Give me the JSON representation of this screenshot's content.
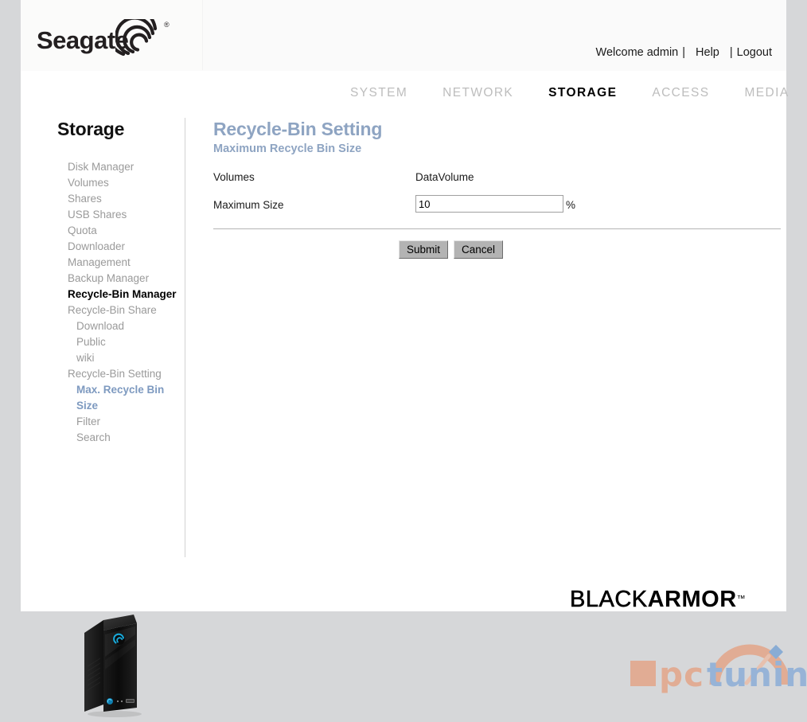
{
  "brand": {
    "logo_text": "Seagate",
    "logo_registered_mark": "®",
    "footer_brand_primary": "BLACK",
    "footer_brand_secondary": "ARMOR",
    "footer_brand_tm": "™",
    "accent_color": "#8ea4c2",
    "active_nav_color": "#000000",
    "inactive_nav_color": "#bdbdbd",
    "page_background": "#d6d7d9"
  },
  "account": {
    "welcome": "Welcome admin",
    "separator": "|",
    "help": "Help",
    "logout": "Logout"
  },
  "nav": {
    "items": [
      {
        "label": "SYSTEM",
        "active": false
      },
      {
        "label": "NETWORK",
        "active": false
      },
      {
        "label": "STORAGE",
        "active": true
      },
      {
        "label": "ACCESS",
        "active": false
      },
      {
        "label": "MEDIA",
        "active": false
      }
    ]
  },
  "sidebar": {
    "title": "Storage",
    "items": [
      {
        "label": "Disk Manager",
        "level": 1,
        "state": "normal"
      },
      {
        "label": "Volumes",
        "level": 1,
        "state": "normal"
      },
      {
        "label": "Shares",
        "level": 1,
        "state": "normal"
      },
      {
        "label": "USB Shares",
        "level": 1,
        "state": "normal"
      },
      {
        "label": "Quota",
        "level": 1,
        "state": "normal"
      },
      {
        "label": "Downloader Management",
        "level": 1,
        "state": "normal"
      },
      {
        "label": "Backup Manager",
        "level": 1,
        "state": "normal"
      },
      {
        "label": "Recycle-Bin Manager",
        "level": 1,
        "state": "active-dark"
      },
      {
        "label": "Recycle-Bin Share",
        "level": 1,
        "state": "normal"
      },
      {
        "label": "Download",
        "level": 2,
        "state": "normal"
      },
      {
        "label": "Public",
        "level": 2,
        "state": "normal"
      },
      {
        "label": "wiki",
        "level": 2,
        "state": "normal"
      },
      {
        "label": "Recycle-Bin Setting",
        "level": 1,
        "state": "normal"
      },
      {
        "label": "Max. Recycle Bin Size",
        "level": 2,
        "state": "active-blue"
      },
      {
        "label": "Filter",
        "level": 2,
        "state": "normal"
      },
      {
        "label": "Search",
        "level": 2,
        "state": "normal"
      }
    ],
    "device_image_name": "blackarmor-nas-device"
  },
  "content": {
    "title": "Recycle-Bin Setting",
    "subtitle": "Maximum Recycle Bin Size",
    "fields": {
      "volumes_label": "Volumes",
      "volumes_value": "DataVolume",
      "max_size_label": "Maximum Size",
      "max_size_value": "10",
      "max_size_placeholder": "",
      "percent_unit": "%"
    },
    "buttons": {
      "submit": "Submit",
      "cancel": "Cancel"
    }
  },
  "watermark": {
    "text_pc": "pc",
    "text_tuning": "tuning",
    "orange": "#e8936b",
    "blue": "#6f9ed6"
  }
}
